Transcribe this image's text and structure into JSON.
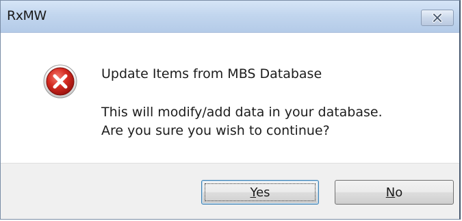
{
  "window": {
    "title": "RxMW"
  },
  "icons": {
    "close": "close-icon",
    "error": "error-icon"
  },
  "message": {
    "title": "Update Items from MBS Database",
    "line1": "This will modify/add data in your database.",
    "line2": "Are you sure you wish to continue?"
  },
  "buttons": {
    "yes": {
      "mnemonic": "Y",
      "rest": "es"
    },
    "no": {
      "mnemonic": "N",
      "rest": "o"
    }
  },
  "colors": {
    "titlebar": "#c2d6ee",
    "error_red": "#d42020",
    "footer": "#f0f0f0"
  }
}
